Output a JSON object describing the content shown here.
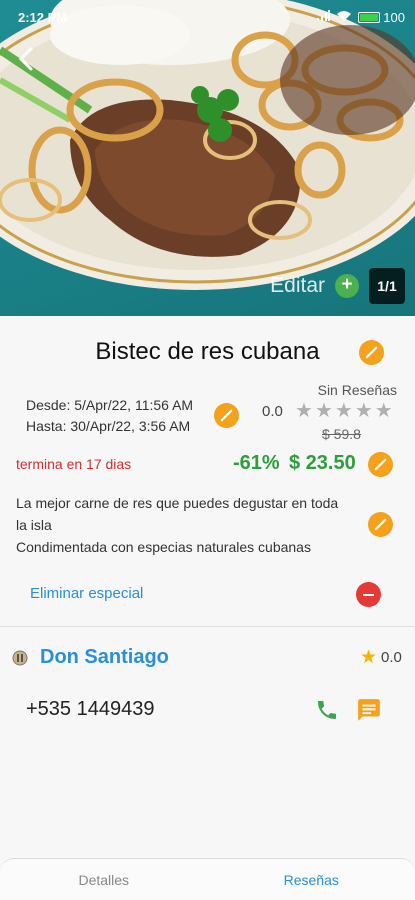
{
  "status_bar": {
    "time": "2:12 PM",
    "battery": "100"
  },
  "hero": {
    "edit_label": "Editar",
    "add_symbol": "+",
    "page_counter": "1/1"
  },
  "item": {
    "title": "Bistec de res cubana",
    "date_from": "Desde: 5/Apr/22, 11:56 AM",
    "date_to": "Hasta: 30/Apr/22, 3:56 AM",
    "reviews_label": "Sin Reseñas",
    "rating": "0.0",
    "stars_total": 5,
    "old_price": "$ 59.8",
    "expires": "termina en 17 dias",
    "discount": "-61%",
    "price": "$ 23.50",
    "description_line1": "La mejor carne de res que puedes degustar en toda la isla",
    "description_line2": "Condimentada con especias naturales cubanas",
    "remove_special": "Eliminar especial"
  },
  "store": {
    "name": "Don Santiago",
    "rating": "0.0",
    "phone": "+535 1449439"
  },
  "tabs": {
    "details": "Detalles",
    "reviews": "Reseñas"
  },
  "colors": {
    "accent_orange": "#f4a11c",
    "price_green": "#2e9d3b",
    "link_blue": "#2a8fd6",
    "alert_red": "#d32f2f"
  }
}
